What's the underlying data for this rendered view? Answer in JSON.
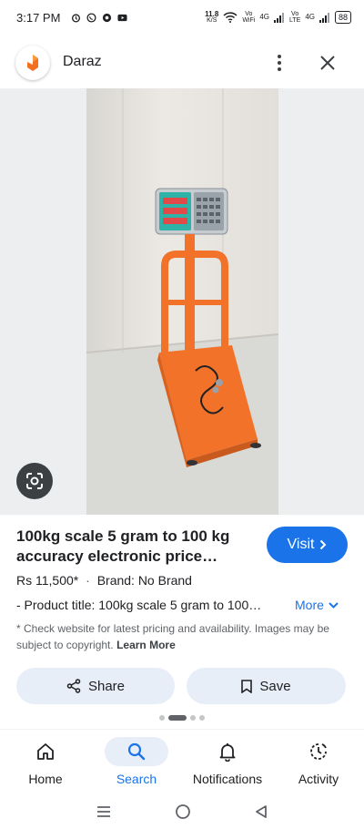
{
  "status_bar": {
    "time": "3:17 PM",
    "net_speed": "11.8",
    "net_unit": "K/S",
    "vo_wifi_top": "Vo",
    "vo_wifi_bottom": "WiFi",
    "sim1_tech": "4G",
    "vo_lte_top": "Vo",
    "vo_lte_bottom": "LTE",
    "sim2_tech": "4G",
    "battery": "88"
  },
  "header": {
    "site_name": "Daraz",
    "logo_icon": "daraz-logo-icon",
    "more_icon": "more-vertical-icon",
    "close_icon": "close-icon"
  },
  "product": {
    "title": "100kg scale 5 gram to 100 kg accuracy electronic price…",
    "price": "Rs 11,500*",
    "separator": "·",
    "brand": "Brand: No Brand",
    "description": "- Product title: 100kg scale 5 gram to 100…",
    "more_label": "More",
    "visit_label": "Visit"
  },
  "disclaimer": {
    "text": "* Check website for latest pricing and availability. Images may be subject to copyright.",
    "link": "Learn More"
  },
  "actions": {
    "share_label": "Share",
    "save_label": "Save"
  },
  "bottom_nav": {
    "items": [
      {
        "label": "Home",
        "icon": "home-icon"
      },
      {
        "label": "Search",
        "icon": "search-icon"
      },
      {
        "label": "Notifications",
        "icon": "bell-icon"
      },
      {
        "label": "Activity",
        "icon": "activity-icon"
      }
    ]
  },
  "colors": {
    "accent": "#1a73e8",
    "button_bg": "#e8eef8",
    "scale_orange": "#f2722a"
  }
}
